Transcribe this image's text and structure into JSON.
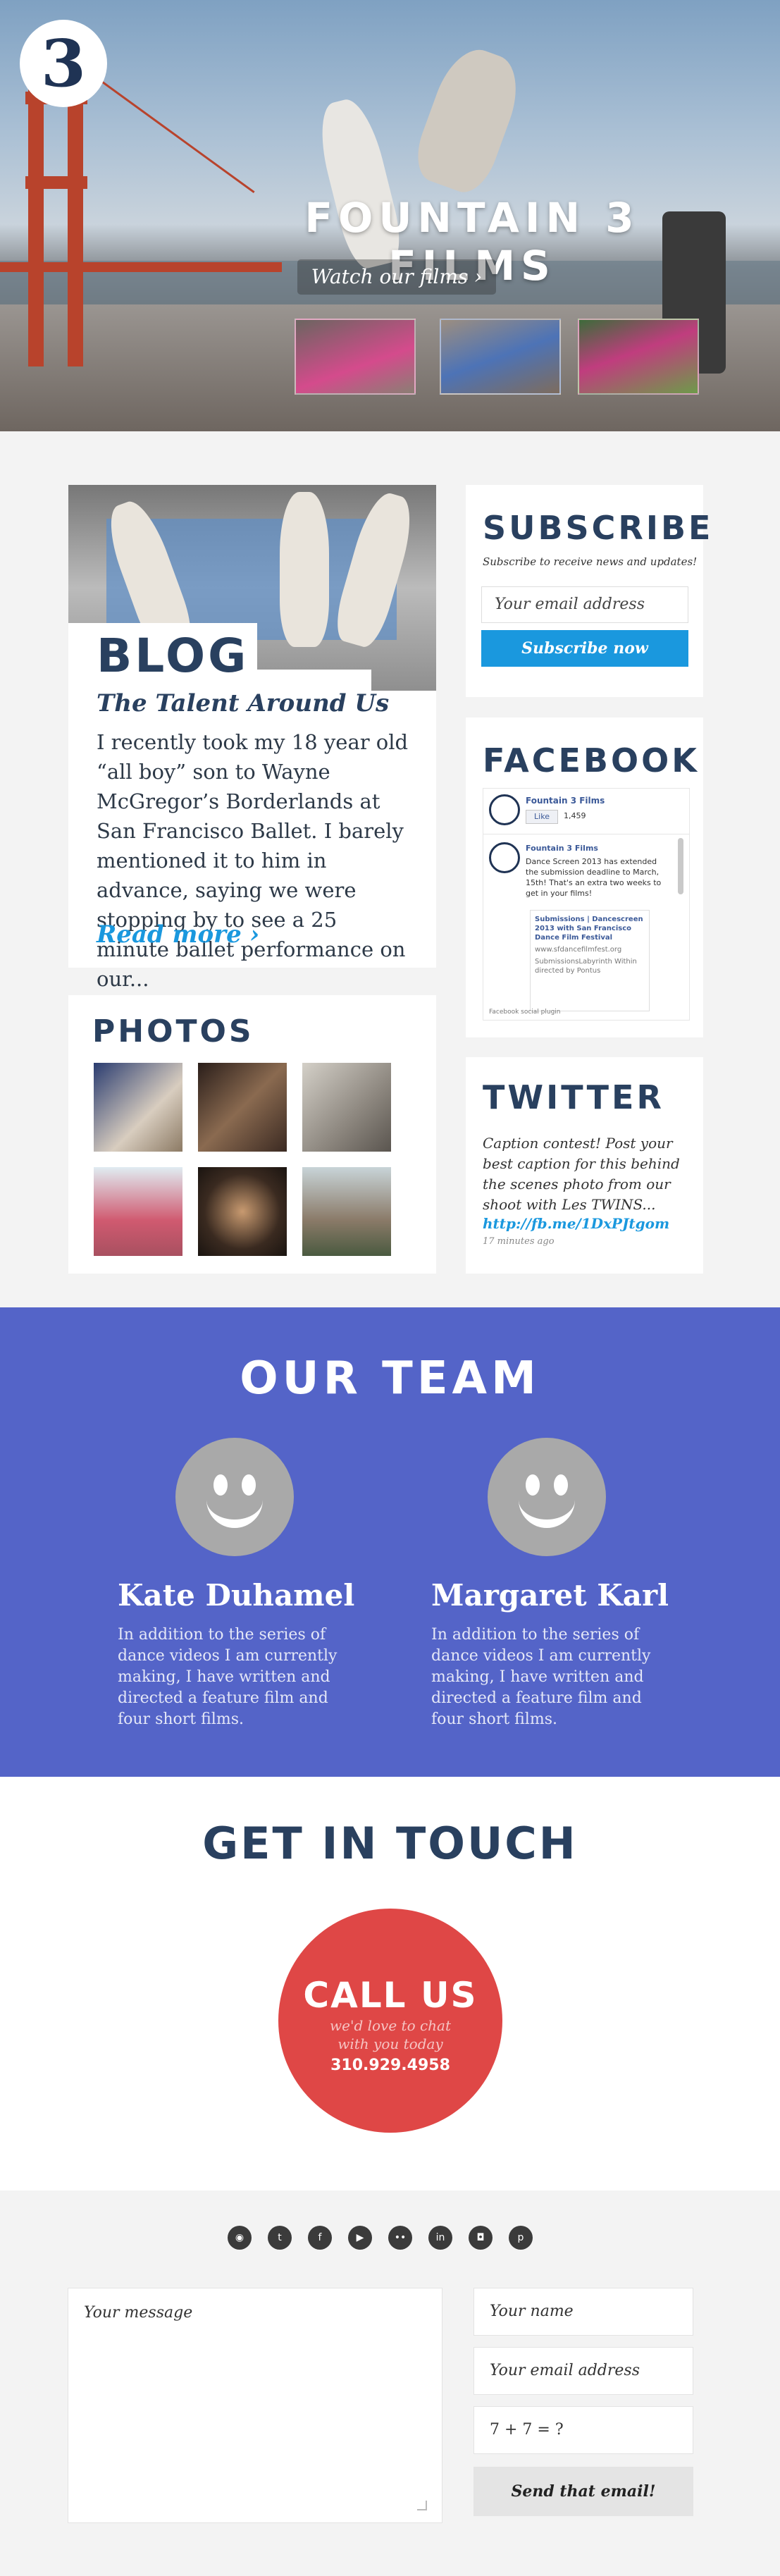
{
  "hero": {
    "logo_glyph": "3",
    "title": "FOUNTAIN 3 FILMS",
    "watch_label": "Watch our films ›"
  },
  "blog": {
    "heading": "BLOG",
    "post_title": "The Talent Around Us",
    "excerpt": "I recently took my 18 year old “all boy” son to Wayne McGregor’s Borderlands at San Francisco Ballet.  I barely mentioned it to him in advance, saying we were stopping by to see a 25 minute ballet performance on our...",
    "read_more": "Read more ›"
  },
  "subscribe": {
    "heading": "SUBSCRIBE",
    "tagline": "Subscribe to receive news and updates!",
    "email_placeholder": "Your email address",
    "button": "Subscribe now"
  },
  "facebook": {
    "heading": "FACEBOOK",
    "page_name": "Fountain 3 Films",
    "like_label": "Like",
    "like_count": "1,459",
    "post_author": "Fountain 3 Films",
    "post_text": "Dance Screen 2013 has extended the submission deadline to March, 15th! That's an extra two weeks to get in your films!",
    "link_title": "Submissions | Dancescreen 2013 with San Francisco Dance Film Festival",
    "link_url": "www.sfdancefilmfest.org",
    "link_more": "SubmissionsLabyrinth Within directed by Pontus",
    "plugin_label": "Facebook social plugin"
  },
  "photos": {
    "heading": "PHOTOS"
  },
  "twitter": {
    "heading": "TWITTER",
    "tweet": "Caption contest! Post your best caption for this behind the scenes photo from our shoot with Les TWINS...",
    "link": "http://fb.me/1DxPJtgom",
    "time": "17 minutes ago"
  },
  "team": {
    "heading": "OUR TEAM",
    "members": [
      {
        "name": "Kate Duhamel",
        "bio": "In addition to the series of dance videos I am currently making, I have written and directed a feature film and four short films."
      },
      {
        "name": "Margaret Karl",
        "bio": "In addition to the series of dance videos I am currently making, I have written and directed a feature film and four short films."
      }
    ]
  },
  "contact": {
    "heading": "GET IN TOUCH",
    "call_title": "CALL US",
    "call_line1": "we'd love to chat",
    "call_line2": "with you today",
    "phone": "310.929.4958"
  },
  "footer": {
    "social_icons": [
      "rss-icon",
      "twitter-icon",
      "facebook-icon",
      "youtube-icon",
      "flickr-icon",
      "linkedin-icon",
      "instagram-icon",
      "pinterest-icon"
    ],
    "message_placeholder": "Your message",
    "name_placeholder": "Your name",
    "email_placeholder": "Your email address",
    "captcha": "7 + 7 = ?",
    "send_button": "Send that email!"
  },
  "colors": {
    "navy": "#29405f",
    "accent_blue": "#1a98de",
    "team_bg": "#5464c8",
    "call_red": "#df4746"
  }
}
